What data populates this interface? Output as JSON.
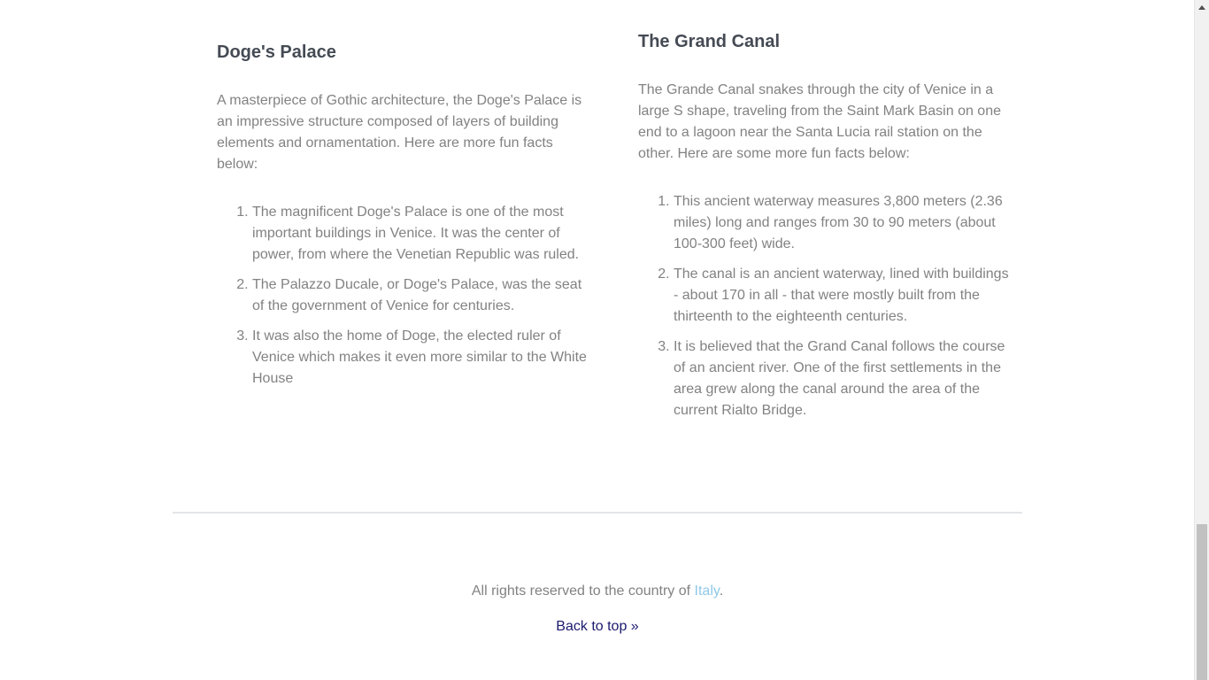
{
  "left_section": {
    "title": "Doge's Palace",
    "intro": "A masterpiece of Gothic architecture, the Doge's Palace is an impressive structure composed of layers of building elements and ornamentation. Here are more fun facts below:",
    "facts": [
      "The magnificent Doge's Palace is one of the most important buildings in Venice. It was the center of power, from where the Venetian Republic was ruled.",
      "The Palazzo Ducale, or Doge's Palace, was the seat of the government of Venice for centuries.",
      "It was also the home of Doge, the elected ruler of Venice which makes it even more similar to the White House"
    ]
  },
  "right_section": {
    "title": "The Grand Canal",
    "intro": "The Grande Canal snakes through the city of Venice in a large S shape, traveling from the Saint Mark Basin on one end to a lagoon near the Santa Lucia rail station on the other. Here are some more fun facts below:",
    "facts": [
      "This ancient waterway measures 3,800 meters (2.36 miles) long and ranges from 30 to 90 meters (about 100-300 feet) wide.",
      "The canal is an ancient waterway, lined with buildings - about 170 in all - that were mostly built from the thirteenth to the eighteenth centuries.",
      "It is believed that the Grand Canal follows the course of an ancient river. One of the first settlements in the area grew along the canal around the area of the current Rialto Bridge."
    ]
  },
  "footer": {
    "rights_prefix": "All rights reserved to the country of ",
    "rights_link": "Italy",
    "rights_suffix": ".",
    "back_to_top": "Back to top »"
  },
  "colors": {
    "heading": "#454b54",
    "body_text": "#828282",
    "link_light": "#8fc8e8",
    "link_dark": "#1a1a6e"
  },
  "icons": {
    "scroll_up": "scroll-up-arrow-icon"
  }
}
